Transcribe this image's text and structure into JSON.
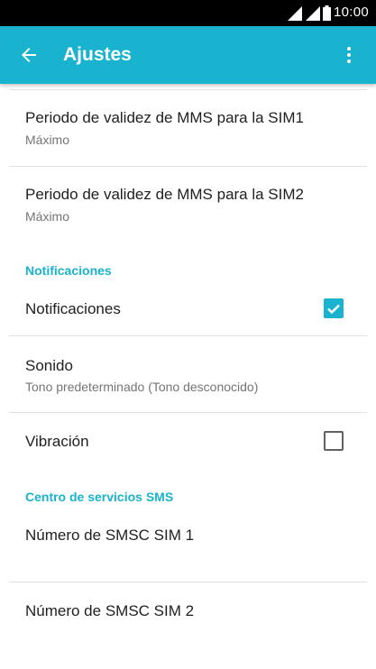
{
  "status_bar": {
    "time": "10:00"
  },
  "app_bar": {
    "title": "Ajustes",
    "back_icon": "arrow-left-icon",
    "menu_icon": "more-vert-icon"
  },
  "theme": {
    "accent": "#1ab3cf"
  },
  "items": {
    "mms_sim1": {
      "title": "Periodo de validez de MMS para la SIM1",
      "summary": "Máximo"
    },
    "mms_sim2": {
      "title": "Periodo de validez de MMS para la SIM2",
      "summary": "Máximo"
    },
    "notifications_header": "Notificaciones",
    "notifications": {
      "title": "Notificaciones",
      "checked": true
    },
    "sound": {
      "title": "Sonido",
      "summary": "Tono predeterminado (Tono desconocido)"
    },
    "vibration": {
      "title": "Vibración",
      "checked": false
    },
    "sms_center_header": "Centro de servicios SMS",
    "smsc_sim1": {
      "title": "Número de SMSC SIM 1"
    },
    "smsc_sim2": {
      "title": "Número de SMSC SIM 2"
    }
  }
}
